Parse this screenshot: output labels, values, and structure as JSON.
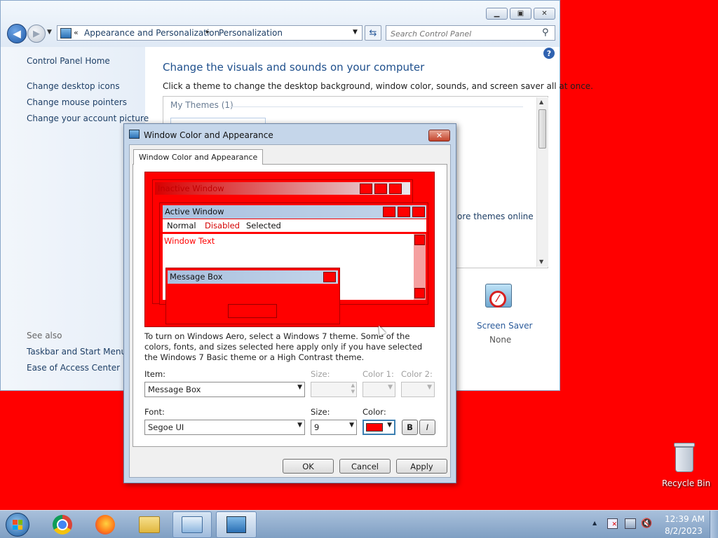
{
  "control_panel": {
    "breadcrumb_prefix": "«",
    "breadcrumb_1": "Appearance and Personalization",
    "breadcrumb_sep": "▸",
    "breadcrumb_2": "Personalization",
    "search_placeholder": "Search Control Panel",
    "left_links": [
      "Control Panel Home",
      "Change desktop icons",
      "Change mouse pointers",
      "Change your account picture"
    ],
    "see_also_title": "See also",
    "see_also_links": [
      "Taskbar and Start Menu",
      "Ease of Access Center"
    ],
    "heading": "Change the visuals and sounds on your computer",
    "subtitle": "Click a theme to change the desktop background, window color, sounds, and screen saver all at once.",
    "my_themes": "My Themes (1)",
    "more_themes": "ore themes online",
    "screen_saver_label": "Screen Saver",
    "screen_saver_value": "None"
  },
  "dialog": {
    "title": "Window Color and Appearance",
    "close_glyph": "✕",
    "tab_label": "Window Color and Appearance",
    "preview": {
      "inactive_window": "Inactive Window",
      "active_window": "Active Window",
      "menu_normal": "Normal",
      "menu_disabled": "Disabled",
      "menu_selected": "Selected",
      "window_text": "Window Text",
      "message_box": "Message Box"
    },
    "info_text": "To turn on Windows Aero, select a Windows 7 theme.  Some of the colors, fonts, and sizes selected here apply only if you have selected the Windows 7 Basic theme or a High Contrast theme.",
    "item_label": "Item:",
    "item_value": "Message Box",
    "size_label": "Size:",
    "size_value": "",
    "color1_label": "Color 1:",
    "color2_label": "Color 2:",
    "font_label": "Font:",
    "font_value": "Segoe UI",
    "font_size_label": "Size:",
    "font_size_value": "9",
    "font_color_label": "Color:",
    "font_color": "#ff0000",
    "bold_label": "B",
    "italic_label": "I",
    "ok_label": "OK",
    "cancel_label": "Cancel",
    "apply_label": "Apply"
  },
  "desktop": {
    "background": "#ff0000",
    "recycle_bin_label": "Recycle Bin"
  },
  "taskbar": {
    "apps": [
      "start-orb",
      "chrome-icon",
      "firefox-icon",
      "explorer-icon",
      "control-panel-icon",
      "appearance-icon"
    ],
    "show_hidden_glyph": "▲",
    "time": "12:39 AM",
    "date": "8/2/2023"
  }
}
